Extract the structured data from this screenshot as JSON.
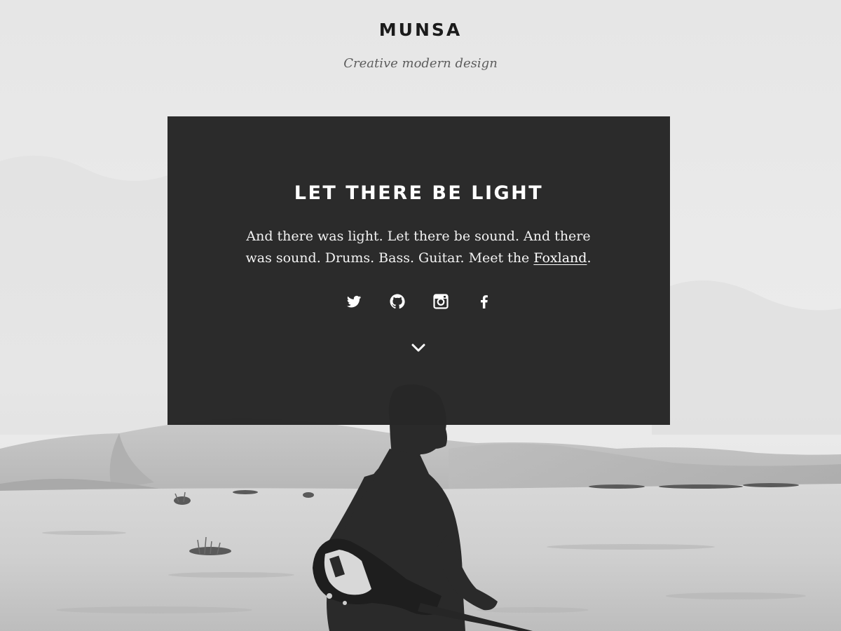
{
  "header": {
    "site_title": "MUNSA",
    "tagline": "Creative modern design"
  },
  "intro": {
    "heading": "LET THERE BE LIGHT",
    "text_before_link": "And there was light. Let there be sound. And there was sound. Drums. Bass. Guitar. Meet the ",
    "link_label": "Foxland",
    "text_after_link": "."
  },
  "social": [
    {
      "icon": "twitter-icon"
    },
    {
      "icon": "github-icon"
    },
    {
      "icon": "instagram-icon"
    },
    {
      "icon": "facebook-icon"
    }
  ],
  "scroll_icon": "chevron-down-icon",
  "colors": {
    "panel_bg": "#282828",
    "panel_text": "#ffffff",
    "title_text": "#1b1b1b",
    "tagline_text": "#5d5d5d",
    "sky": "#e9e9e9",
    "sand": "#d9d9d9"
  }
}
